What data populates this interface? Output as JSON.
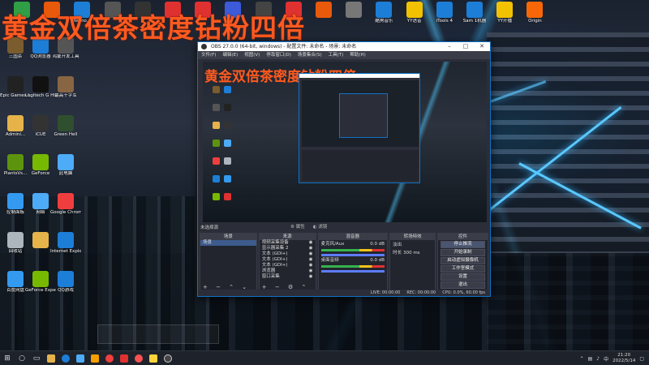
{
  "overlay_title": "黄金双倍茶密度钻粉四倍",
  "desktop_icons_top": [
    {
      "label": "",
      "name": "top-app-1",
      "color": "#2f9e44"
    },
    {
      "label": "",
      "name": "top-app-2",
      "color": "#e8590c"
    },
    {
      "label": "Nemo...",
      "name": "top-app-3",
      "color": "#1c7ed6"
    },
    {
      "label": "",
      "name": "top-app-4",
      "color": "#555"
    },
    {
      "label": "",
      "name": "top-app-5",
      "color": "#333"
    },
    {
      "label": "",
      "name": "top-app-6",
      "color": "#e03131"
    },
    {
      "label": "",
      "name": "top-app-7",
      "color": "#e03131"
    },
    {
      "label": "",
      "name": "top-app-8",
      "color": "#3b5bdb"
    },
    {
      "label": "",
      "name": "top-app-9",
      "color": "#444"
    },
    {
      "label": "",
      "name": "top-app-10",
      "color": "#e03131"
    },
    {
      "label": "",
      "name": "top-app-11",
      "color": "#e8590c"
    },
    {
      "label": "",
      "name": "top-app-12",
      "color": "#777"
    },
    {
      "label": "酷狗音乐",
      "name": "kugou-icon",
      "color": "#1c7ed6"
    },
    {
      "label": "YY语音",
      "name": "yy-voice-icon",
      "color": "#f2c200"
    },
    {
      "label": "iTools 4",
      "name": "itools-icon",
      "color": "#1c7ed6"
    },
    {
      "label": "Sam 1机器",
      "name": "sam-icon",
      "color": "#1c7ed6"
    },
    {
      "label": "YY开播",
      "name": "yy-live-icon",
      "color": "#f2c200"
    },
    {
      "label": "Origin",
      "name": "origin-icon",
      "color": "#f76707"
    }
  ],
  "desktop_icons_left": [
    {
      "label": "三国杀",
      "name": "sanguosha-icon",
      "color": "#7a5c2e"
    },
    {
      "label": "QQ浏览器",
      "name": "qq-browser-icon",
      "color": "#1c7ed6"
    },
    {
      "label": "鸿蒙开发工具",
      "name": "harmony-tool-icon",
      "color": "#555"
    },
    {
      "label": "Epic Games Launcher",
      "name": "epic-games-icon",
      "color": "#222"
    },
    {
      "label": "Logitech G HUB",
      "name": "logitech-ghub-icon",
      "color": "#111"
    },
    {
      "label": "最高十字军",
      "name": "game-icon-a",
      "color": "#864"
    },
    {
      "label": "Admini...",
      "name": "admin-folder-icon",
      "color": "#e6b34a"
    },
    {
      "label": "iCUE",
      "name": "icue-icon",
      "color": "#333"
    },
    {
      "label": "Green Hell",
      "name": "green-hell-icon",
      "color": "#2f4f2f"
    },
    {
      "label": "PlantsVs...",
      "name": "plants-vs-icon",
      "color": "#5c940d"
    },
    {
      "label": "GeForce",
      "name": "geforce-icon-a",
      "color": "#76b900"
    },
    {
      "label": "此电脑",
      "name": "this-pc-icon",
      "color": "#4dabf7"
    },
    {
      "label": "控制面板",
      "name": "control-panel-icon",
      "color": "#339af0"
    },
    {
      "label": "网络",
      "name": "network-icon",
      "color": "#4dabf7"
    },
    {
      "label": "Google Chrome",
      "name": "chrome-icon",
      "color": "#f03e3e"
    },
    {
      "label": "回收站",
      "name": "recycle-bin-icon",
      "color": "#adb5bd"
    },
    {
      "label": "",
      "name": "folder-icon",
      "color": "#e6b34a"
    },
    {
      "label": "Internet Explorer",
      "name": "ie-icon",
      "color": "#1c7ed6"
    },
    {
      "label": "百度网盘",
      "name": "baidu-netdisk-icon",
      "color": "#339af0"
    },
    {
      "label": "GeForce Experience",
      "name": "geforce-experience-icon",
      "color": "#76b900"
    },
    {
      "label": "QQ游戏",
      "name": "qq-game-icon",
      "color": "#1c7ed6"
    }
  ],
  "obs": {
    "title": "OBS 27.0.0 (64-bit, windows) - 配置文件: 未命名 - 场景: 未命名",
    "menu": [
      "文件(F)",
      "编辑(E)",
      "视图(V)",
      "停靠窗口(D)",
      "场景集合(S)",
      "工具(T)",
      "帮助(H)"
    ],
    "no_source_label": "未选择源",
    "props_label": "属性",
    "filters_label": "滤镜",
    "docks": {
      "scenes": {
        "header": "场景",
        "items": [
          "场景"
        ]
      },
      "sources": {
        "header": "来源",
        "items": [
          "视频采集设备",
          "显示器采集 2",
          "文本 (GDI+)",
          "文本 (GDI+)",
          "文本 (GDI+)",
          "浏览器",
          "窗口采集"
        ]
      },
      "mixer": {
        "header": "混音器",
        "tracks": [
          {
            "name": "麦克风/Aux",
            "db": "0.0 dB"
          },
          {
            "name": "桌面音频",
            "db": "0.0 dB"
          }
        ]
      },
      "transitions": {
        "header": "转场特效",
        "type": "淡出",
        "duration_label": "时长",
        "duration_value": "300 ms"
      },
      "controls": {
        "header": "控件",
        "buttons": [
          "停止推流",
          "开始录制",
          "启动虚拟摄像机",
          "工作室模式",
          "设置",
          "退出"
        ]
      }
    },
    "status": {
      "live": "LIVE: 00:00:00",
      "rec": "REC: 00:00:00",
      "cpu": "CPU: 0.0%, 60.00 fps"
    },
    "inner_title": "黄金双倍茶密度钻粉四倍"
  },
  "taskbar": {
    "time": "21:20",
    "date": "2022/5/14",
    "lang": "中"
  }
}
